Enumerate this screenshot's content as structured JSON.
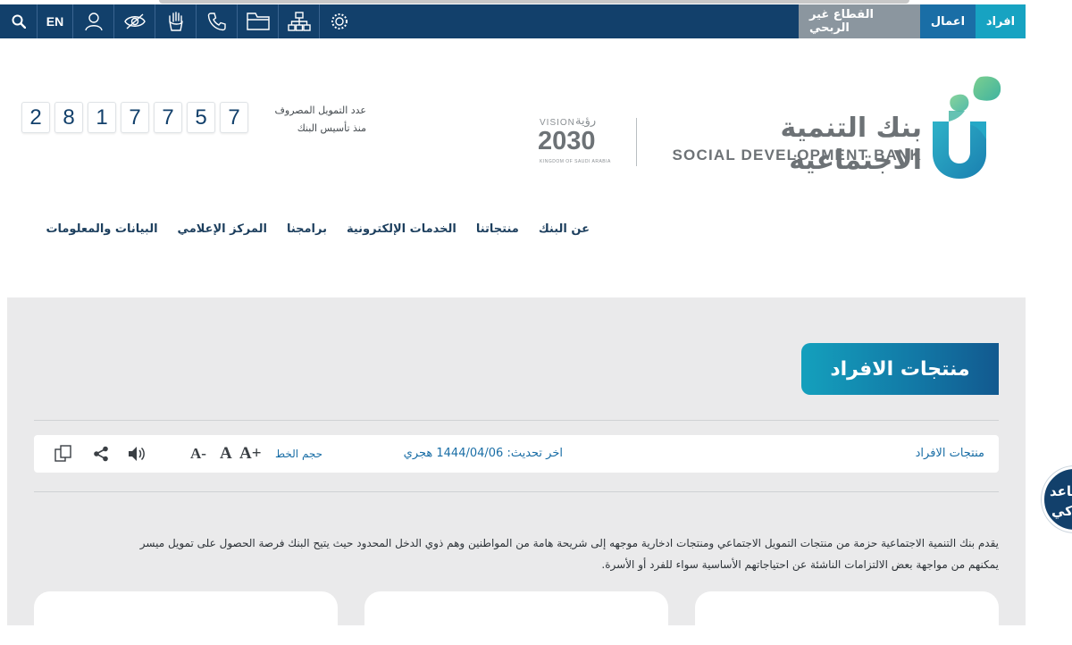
{
  "topbar": {
    "segments": [
      "افراد",
      "اعمال",
      "القطاع غير الربحي"
    ],
    "language": "EN",
    "tools": [
      "search-icon",
      "user-icon",
      "eye-off-icon",
      "sign-language-icon",
      "phone-icon",
      "folder-icon",
      "sitemap-icon",
      "settings-icon"
    ],
    "colors": {
      "bar": "#12406b",
      "individuals": "#17a3c2",
      "business": "#1a6ea6",
      "nonprofit": "#8b969f"
    }
  },
  "header": {
    "bank_name_ar": "بنك التنمية الاجتماعية",
    "bank_name_en": "SOCIAL DEVELOPMENT BANK",
    "vision": {
      "label": "VISION",
      "label_ar": "رؤية",
      "year": "2030",
      "kingdom": "KINGDOM OF SAUDI ARABIA"
    },
    "counter": {
      "digits": [
        "2",
        "8",
        "1",
        "7",
        "7",
        "5",
        "7"
      ],
      "caption_line1": "عدد التمويل المصروف",
      "caption_line2": "منذ تأسيس البنك"
    }
  },
  "nav": {
    "items": [
      "عن البنك",
      "منتجاتنا",
      "الخدمات الإلكترونية",
      "برامجنا",
      "المركز الإعلامي",
      "البيانات والمعلومات"
    ]
  },
  "page": {
    "title": "منتجات الافراد",
    "breadcrumb": "منتجات الافراد",
    "last_update": "اخر تحديث: 1444/04/06 هجري",
    "font_size_label": "حجم الخط",
    "font_buttons": [
      "A+",
      "A",
      "A-"
    ],
    "description_line1": "يقدم بنك التنمية الاجتماعية حزمة من منتجات التمويل الاجتماعي ومنتجات ادخارية موجهه إلى شريحة هامة من المواطنين وهم ذوي الدخل المحدود حيث يتيح البنك فرصة الحصول على تمويل ميسر",
    "description_line2": "يمكنهم من مواجهة بعض الالتزامات الناشئة عن احتياجاتهم الأساسية سواء للفرد أو الأسرة."
  },
  "assistant": {
    "line1": "ساعد",
    "line2": "ذكي"
  }
}
